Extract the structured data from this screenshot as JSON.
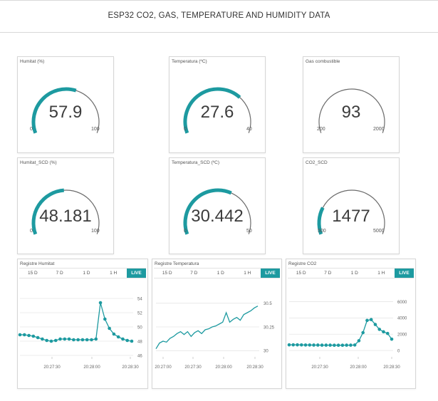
{
  "header": {
    "title": "ESP32 CO2, GAS, TEMPERATURE AND HUMIDITY DATA"
  },
  "colors": {
    "accent": "#1d9aa0",
    "track": "#6b6b6b",
    "grid": "#e6e6e6"
  },
  "gauges": [
    {
      "label": "Humitat (%)",
      "value": "57.9",
      "num": 57.9,
      "min": "0",
      "max": "100",
      "minN": 0,
      "maxN": 100
    },
    {
      "label": "Temperatura (ºC)",
      "value": "27.6",
      "num": 27.6,
      "min": "0",
      "max": "40",
      "minN": 0,
      "maxN": 40
    },
    {
      "label": "Gas combustible",
      "value": "93",
      "num": 93,
      "min": "200",
      "max": "2000",
      "minN": 200,
      "maxN": 2000
    },
    {
      "label": "Humitat_SCD (%)",
      "value": "48.181",
      "num": 48.181,
      "min": "0",
      "max": "100",
      "minN": 0,
      "maxN": 100
    },
    {
      "label": "Temperatura_SCD (ºC)",
      "value": "30.442",
      "num": 30.442,
      "min": "0",
      "max": "50",
      "minN": 0,
      "maxN": 50
    },
    {
      "label": "CO2_SCD",
      "value": "1477",
      "num": 1477,
      "min": "500",
      "max": "5000",
      "minN": 500,
      "maxN": 5000
    }
  ],
  "time_tabs": [
    "15 D",
    "7 D",
    "1 D",
    "1 H",
    "LIVE"
  ],
  "charts": [
    {
      "label": "Registre Humitat",
      "ylim": [
        46,
        54
      ],
      "yticks": [
        "54",
        "52",
        "50",
        "48",
        "46"
      ],
      "ytick_vals": [
        54,
        52,
        50,
        48,
        46
      ],
      "xticks": [
        "20:27:30",
        "20:28:00",
        "20:28:30"
      ],
      "markers": true,
      "values": [
        48.9,
        48.9,
        48.8,
        48.7,
        48.5,
        48.3,
        48.1,
        48.0,
        48.1,
        48.3,
        48.3,
        48.3,
        48.2,
        48.2,
        48.2,
        48.2,
        48.2,
        48.3,
        53.4,
        51.1,
        49.8,
        49.0,
        48.6,
        48.3,
        48.1,
        48.0
      ]
    },
    {
      "label": "Registre Temperatura",
      "ylim": [
        29.95,
        30.55
      ],
      "yticks": [
        "30.5",
        "30.25",
        "30"
      ],
      "ytick_vals": [
        30.5,
        30.25,
        30.0
      ],
      "xticks": [
        "20:27:00",
        "20:27:30",
        "20:28:00",
        "20:28:30"
      ],
      "markers": false,
      "values": [
        30.02,
        30.08,
        30.1,
        30.09,
        30.13,
        30.15,
        30.18,
        30.2,
        30.17,
        30.2,
        30.15,
        30.19,
        30.21,
        30.18,
        30.22,
        30.23,
        30.25,
        30.26,
        30.28,
        30.3,
        30.4,
        30.3,
        30.33,
        30.35,
        30.32,
        30.38,
        30.4,
        30.42,
        30.45,
        30.47
      ]
    },
    {
      "label": "Registre CO2",
      "ylim": [
        -600,
        6400
      ],
      "yticks": [
        "6000",
        "4000",
        "2000",
        "0"
      ],
      "ytick_vals": [
        6000,
        4000,
        2000,
        0
      ],
      "xticks": [
        "20:27:30",
        "20:28:00",
        "20:28:30"
      ],
      "markers": true,
      "values": [
        700,
        700,
        700,
        690,
        680,
        680,
        670,
        670,
        660,
        660,
        660,
        650,
        650,
        650,
        660,
        660,
        680,
        1200,
        2200,
        3700,
        3800,
        3200,
        2600,
        2300,
        2100,
        1400
      ]
    }
  ]
}
